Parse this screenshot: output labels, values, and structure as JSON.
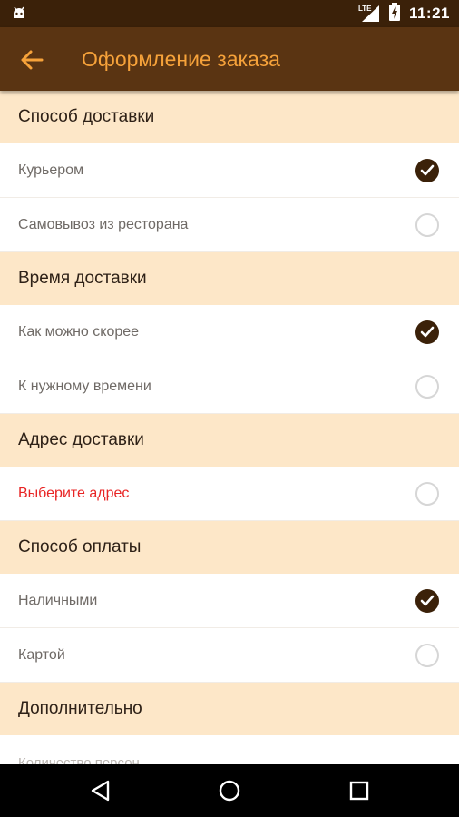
{
  "status_bar": {
    "time": "11:21",
    "network": "LTE",
    "icons": [
      "android-icon",
      "signal-icon",
      "battery-icon"
    ]
  },
  "app_bar": {
    "title": "Оформление заказа",
    "back_icon": "arrow-back-icon",
    "accent_color": "#f6a23a",
    "background_color": "#5a3412"
  },
  "sections": [
    {
      "title": "Способ доставки",
      "options": [
        {
          "label": "Курьером",
          "selected": true
        },
        {
          "label": "Самовывоз из ресторана",
          "selected": false
        }
      ]
    },
    {
      "title": "Время доставки",
      "options": [
        {
          "label": "Как можно скорее",
          "selected": true
        },
        {
          "label": "К нужному времени",
          "selected": false
        }
      ]
    },
    {
      "title": "Адрес доставки",
      "options": [
        {
          "label": "Выберите адрес",
          "selected": false,
          "error": true
        }
      ]
    },
    {
      "title": "Способ оплаты",
      "options": [
        {
          "label": "Наличными",
          "selected": true
        },
        {
          "label": "Картой",
          "selected": false
        }
      ]
    },
    {
      "title": "Дополнительно",
      "options": [
        {
          "label": "Количество персон"
        }
      ]
    }
  ],
  "colors": {
    "section_background": "#fde7c8",
    "checked": "#3b2109",
    "error": "#e82525"
  },
  "nav_bar": {
    "icons": [
      "back-triangle-icon",
      "home-circle-icon",
      "recents-square-icon"
    ]
  }
}
